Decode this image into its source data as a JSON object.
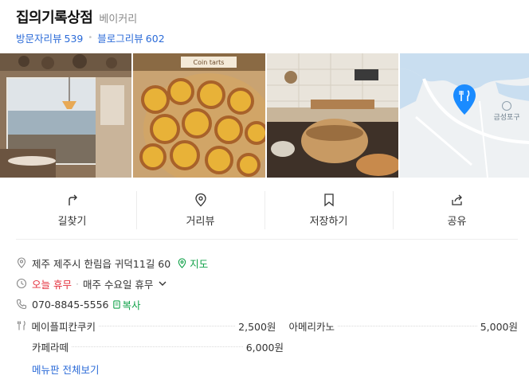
{
  "place": {
    "name": "집의기록상점",
    "category": "베이커리",
    "visitor_reviews_label": "방문자리뷰",
    "visitor_reviews_count": "539",
    "blog_reviews_label": "블로그리뷰",
    "blog_reviews_count": "602"
  },
  "photos": {
    "tart_sign": "Coin tarts"
  },
  "map": {
    "place_label": "금성포구"
  },
  "actions": [
    {
      "label": "길찾기",
      "icon": "directions-icon"
    },
    {
      "label": "거리뷰",
      "icon": "location-pin-icon"
    },
    {
      "label": "저장하기",
      "icon": "bookmark-icon"
    },
    {
      "label": "공유",
      "icon": "share-icon"
    }
  ],
  "info": {
    "address": "제주 제주시 한림읍 귀덕11길 60",
    "map_link": "지도",
    "status": "오늘 휴무",
    "hours": "매주 수요일 휴무",
    "phone": "070-8845-5556",
    "copy_label": "복사"
  },
  "menu": {
    "items": [
      {
        "name": "메이플피칸쿠키",
        "price": "2,500원"
      },
      {
        "name": "아메리카노",
        "price": "5,000원"
      },
      {
        "name": "카페라떼",
        "price": "6,000원"
      }
    ],
    "more_label": "메뉴판 전체보기"
  },
  "colors": {
    "link_blue": "#2b6bd8",
    "green": "#12a24a",
    "closed_red": "#e4313e",
    "map_pin_blue": "#1a8bff"
  }
}
